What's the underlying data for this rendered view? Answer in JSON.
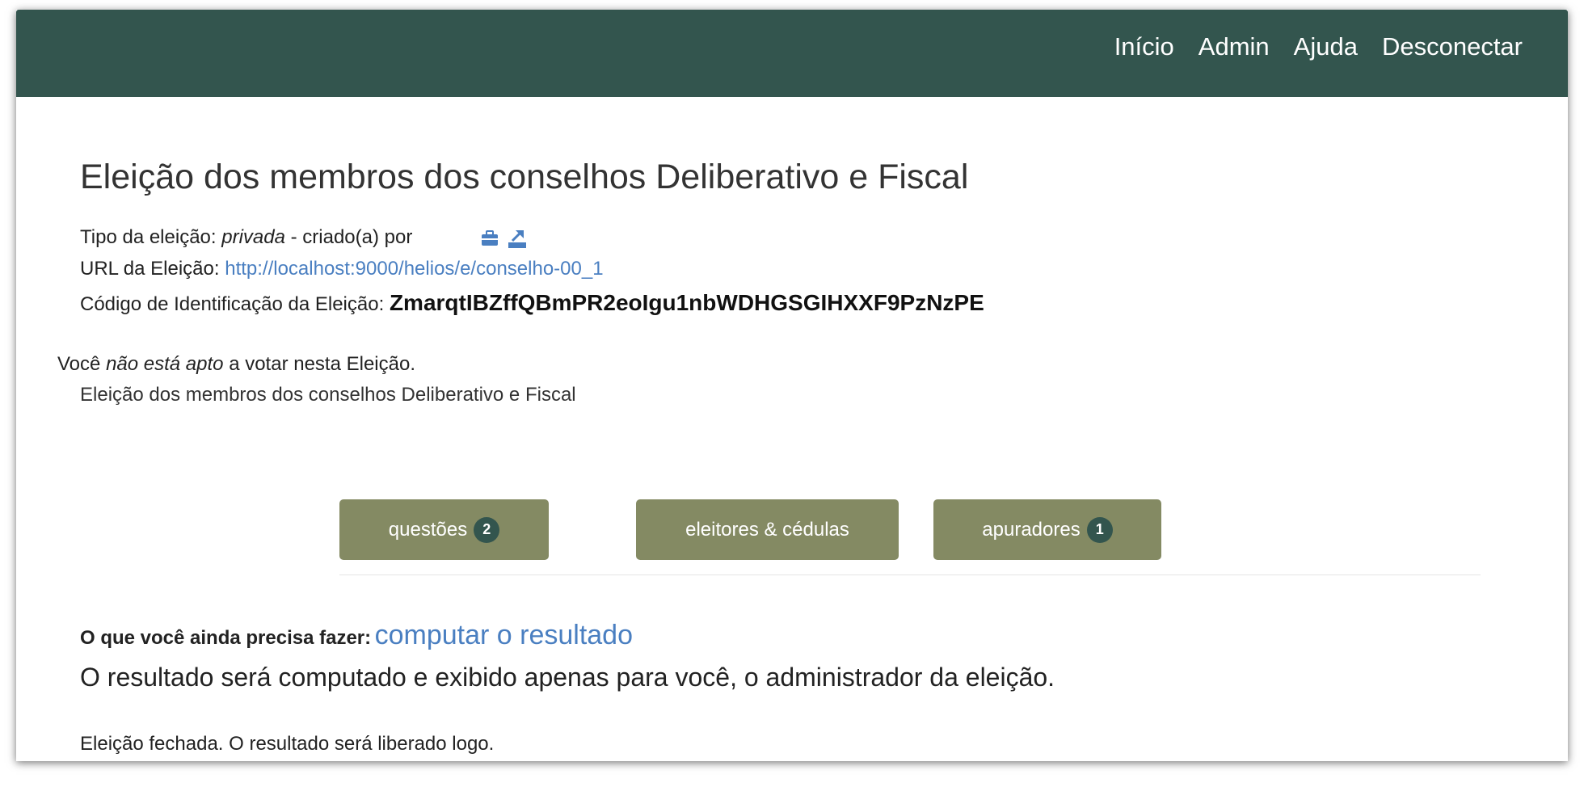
{
  "nav": {
    "home": "Início",
    "admin": "Admin",
    "help": "Ajuda",
    "logout": "Desconectar"
  },
  "election": {
    "title": "Eleição dos membros dos conselhos Deliberativo e Fiscal",
    "type_label": "Tipo da eleição:",
    "type_value": "privada",
    "created_by": "- criado(a) por",
    "url_label": "URL da Eleição:",
    "url": "http://localhost:9000/helios/e/conselho-00_1",
    "code_label": "Código de Identificação da Eleição:",
    "code": "ZmarqtIBZffQBmPR2eoIgu1nbWDHGSGIHXXF9PzNzPE"
  },
  "eligibility": {
    "prefix": "Você",
    "emphasis": "não está apto",
    "suffix": "a votar nesta Eleição.",
    "election_name": "Eleição dos membros dos conselhos Deliberativo e Fiscal"
  },
  "buttons": {
    "questions": {
      "label": "questões",
      "count": "2"
    },
    "voters": {
      "label": "eleitores & cédulas"
    },
    "trustees": {
      "label": "apuradores",
      "count": "1"
    }
  },
  "todo": {
    "label": "O que você ainda precisa fazer:",
    "link": "computar o resultado",
    "note": "O resultado será computado e exibido apenas para você, o administrador da eleição."
  },
  "status": {
    "closed": "Eleição fechada. O resultado será liberado logo."
  },
  "icons": [
    "briefcase-icon",
    "export-icon"
  ],
  "colors": {
    "navbar": "#33554e",
    "button": "#848a63",
    "link": "#4a7fc1"
  }
}
